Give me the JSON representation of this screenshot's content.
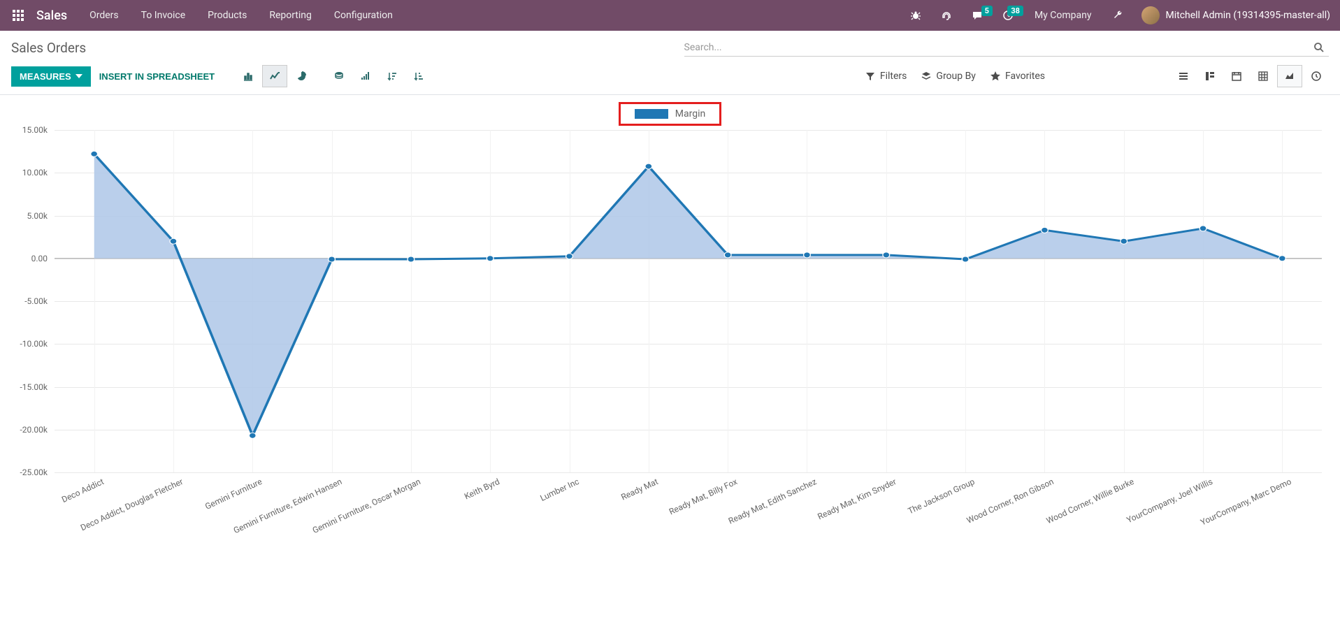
{
  "navbar": {
    "brand": "Sales",
    "links": [
      "Orders",
      "To Invoice",
      "Products",
      "Reporting",
      "Configuration"
    ],
    "chat_badge": "5",
    "clock_badge": "38",
    "company": "My Company",
    "user": "Mitchell Admin (19314395-master-all)"
  },
  "control": {
    "title": "Sales Orders",
    "search_placeholder": "Search...",
    "measures_btn": "MEASURES",
    "insert_btn": "INSERT IN SPREADSHEET",
    "filters_label": "Filters",
    "groupby_label": "Group By",
    "favorites_label": "Favorites"
  },
  "legend_label": "Margin",
  "chart_data": {
    "type": "line",
    "ylabel": "",
    "xlabel": "",
    "title": "",
    "ylim": [
      -25000,
      15000
    ],
    "y_ticks": [
      "15.00k",
      "10.00k",
      "5.00k",
      "0.00",
      "-5.00k",
      "-10.00k",
      "-15.00k",
      "-20.00k",
      "-25.00k"
    ],
    "categories": [
      "Deco Addict",
      "Deco Addict, Douglas Fletcher",
      "Gemini Furniture",
      "Gemini Furniture, Edwin Hansen",
      "Gemini Furniture, Oscar Morgan",
      "Keith Byrd",
      "Lumber Inc",
      "Ready Mat",
      "Ready Mat, Billy Fox",
      "Ready Mat, Edith Sanchez",
      "Ready Mat, Kim Snyder",
      "The Jackson Group",
      "Wood Corner, Ron Gibson",
      "Wood Corner, Willie Burke",
      "YourCompany, Joel Willis",
      "YourCompany, Marc Demo"
    ],
    "series": [
      {
        "name": "Margin",
        "values": [
          12200,
          2000,
          -20700,
          -100,
          -100,
          0,
          250,
          10750,
          400,
          400,
          400,
          -100,
          3300,
          2000,
          3500,
          0
        ]
      }
    ]
  }
}
